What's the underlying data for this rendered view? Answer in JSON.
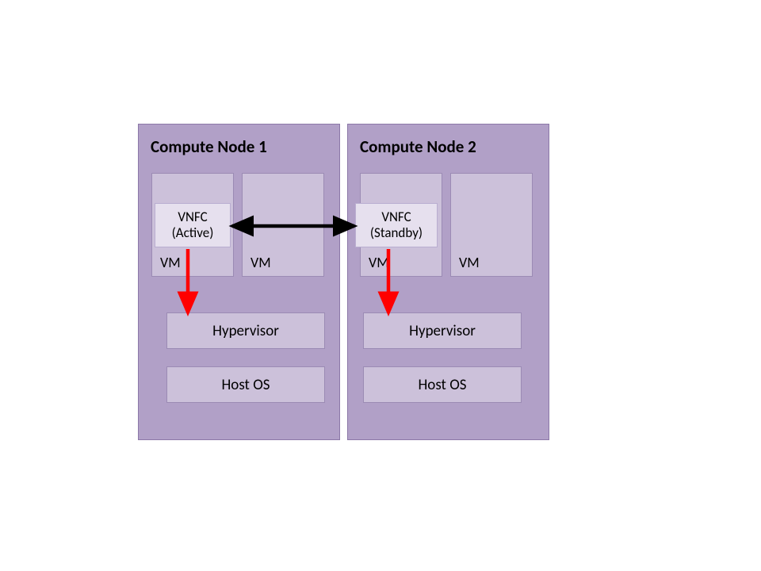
{
  "nodes": [
    {
      "title": "Compute Node 1",
      "vnfc_line1": "VNFC",
      "vnfc_line2": "(Active)",
      "vm1": "VM",
      "vm2": "VM",
      "hypervisor": "Hypervisor",
      "host_os": "Host OS"
    },
    {
      "title": "Compute Node 2",
      "vnfc_line1": "VNFC",
      "vnfc_line2": "(Standby)",
      "vm1": "VM",
      "vm2": "VM",
      "hypervisor": "Hypervisor",
      "host_os": "Host OS"
    }
  ],
  "connections": {
    "vnfc_link": "bidirectional",
    "red_arrows": "vnfc-to-hypervisor"
  }
}
